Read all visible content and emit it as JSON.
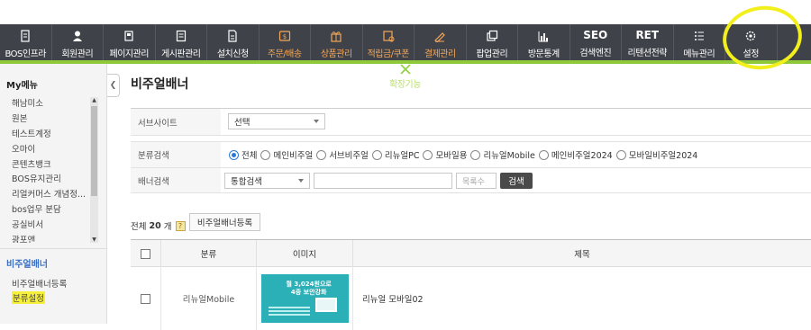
{
  "nav": [
    {
      "label": "BOS인프라",
      "icon": "document-icon"
    },
    {
      "label": "회원관리",
      "icon": "user-icon"
    },
    {
      "label": "페이지관리",
      "icon": "pages-icon"
    },
    {
      "label": "게시판관리",
      "icon": "board-icon"
    },
    {
      "label": "설치신청",
      "icon": "install-icon"
    },
    {
      "label": "주문/배송",
      "icon": "order-icon",
      "style": "orange"
    },
    {
      "label": "상품관리",
      "icon": "gift-icon",
      "style": "orange"
    },
    {
      "label": "적립금/쿠폰",
      "icon": "coupon-icon",
      "style": "orange"
    },
    {
      "label": "결제관리",
      "icon": "payment-icon",
      "style": "orange"
    },
    {
      "label": "팝업관리",
      "icon": "popup-icon"
    },
    {
      "label": "방문통계",
      "icon": "bar-chart-icon"
    },
    {
      "label": "검색엔진",
      "icon_text": "SEO"
    },
    {
      "label": "리텐션전략",
      "icon_text": "RET"
    },
    {
      "label": "메뉴관리",
      "icon": "menu-list-icon"
    },
    {
      "label": "확장기능",
      "icon": "tools-icon",
      "style": "green"
    },
    {
      "label": "설정",
      "icon": "gear-icon"
    }
  ],
  "sidebar": {
    "title": "My메뉴",
    "items": [
      "해남미소",
      "원본",
      "테스트계정",
      "오마이",
      "콘텐츠뱅크",
      "BOS유지관리",
      "리얼커머스 개념정...",
      "bos업무 분담",
      "공실비서",
      "광포앤"
    ],
    "section_title": "비주얼배너",
    "sub_items": [
      "비주얼배너등록",
      "분류설정"
    ]
  },
  "page": {
    "title": "비주얼배너"
  },
  "filter": {
    "service_label": "서브사이트",
    "service_value": "선택",
    "category_label": "분류검색",
    "category_options": [
      "전체",
      "메인비주얼",
      "서브비주얼",
      "리뉴얼PC",
      "모바일용",
      "리뉴얼Mobile",
      "메인비주얼2024",
      "모바일비주얼2024"
    ],
    "category_selected": "전체",
    "banner_label": "배너검색",
    "banner_select": "통합검색",
    "search_value": "",
    "count_placeholder": "목록수",
    "search_button": "검색"
  },
  "list": {
    "total_prefix": "전체",
    "total_count": "20",
    "total_suffix": "개",
    "help": "?",
    "register_button": "비주얼배너등록",
    "columns": [
      "분류",
      "이미지",
      "제목"
    ],
    "rows": [
      {
        "category": "리뉴얼Mobile",
        "image_text": "월 3,024원으로\n4중 보안강화",
        "title": "리뉴얼 모바일02"
      }
    ]
  },
  "colors": {
    "nav_bg": "#3f4249",
    "nav_accent": "#8fc93a",
    "highlight": "#f2ef1c",
    "link": "#3a6fc4"
  }
}
